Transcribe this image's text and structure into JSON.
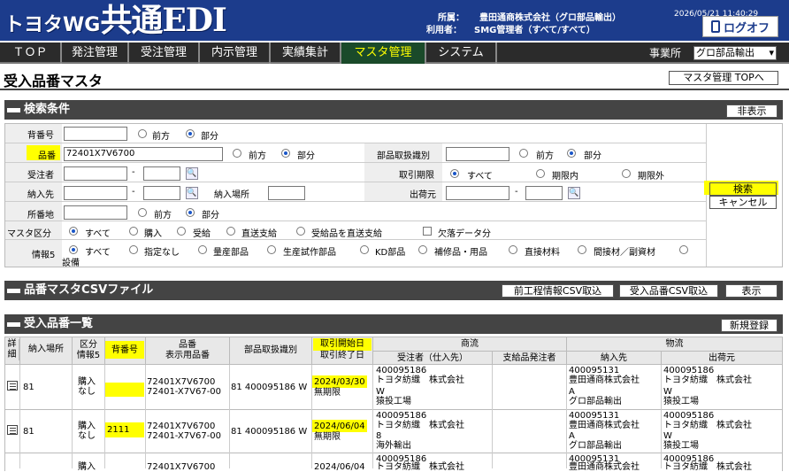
{
  "header": {
    "logo_small": "トヨタWG",
    "logo_big": "共通EDI",
    "affiliation_label": "所属：",
    "affiliation": "豊田通商株式会社（グロ部品輸出）",
    "user_label": "利用者：",
    "user": "SMG管理者（すべて/すべて）",
    "datetime": "2026/05/21 11:40:29",
    "logoff": "ログオフ"
  },
  "nav": {
    "items": [
      "ＴＯＰ",
      "発注管理",
      "受注管理",
      "内示管理",
      "実績集計",
      "マスタ管理",
      "システム"
    ],
    "office_label": "事業所",
    "office_value": "グロ部品輸出"
  },
  "page": {
    "title": "受入品番マスタ",
    "master_top": "マスタ管理 TOPへ"
  },
  "search": {
    "section_title": "検索条件",
    "hide": "非表示",
    "labels": {
      "sebango": "背番号",
      "hinban": "品番",
      "buhin": "部品取扱識別",
      "juchusha": "受注者",
      "torihiki": "取引期限",
      "nonyusaki": "納入先",
      "nonyubasho": "納入場所",
      "shukkamoto": "出荷元",
      "shozokuchi": "所番地",
      "master_kubun": "マスタ区分",
      "joho5": "情報5"
    },
    "hinban_value": "72401X7V6700",
    "opt_front": "前方",
    "opt_part": "部分",
    "opt_all": "すべて",
    "opt_within": "期限内",
    "opt_out": "期限外",
    "master_opts": [
      "すべて",
      "購入",
      "受給",
      "直送支給",
      "受給品を直送支給"
    ],
    "missing": "欠落データ分",
    "joho_opts": [
      "すべて",
      "指定なし",
      "量産部品",
      "生産試作部品",
      "KD部品",
      "補修品・用品",
      "直接材料",
      "間接材／副資材",
      "設備"
    ],
    "search_btn": "検索",
    "cancel_btn": "キャンセル"
  },
  "csv": {
    "section_title": "品番マスタCSVファイル",
    "btn1": "前工程情報CSV取込",
    "btn2": "受入品番CSV取込",
    "btn3": "表示"
  },
  "list": {
    "section_title": "受入品番一覧",
    "new_btn": "新規登録",
    "headers": {
      "detail": "詳細",
      "place": "納入場所",
      "kubun": "区分",
      "joho": "情報5",
      "sebango": "背番号",
      "hinban1": "品番",
      "hinban2": "表示用品番",
      "buhin": "部品取扱識別",
      "start": "取引開始日",
      "end": "取引終了日",
      "shoryu": "商流",
      "juchusha": "受注者（仕入先）",
      "shikyu": "支給品発注者",
      "butsuryu": "物流",
      "nonyusaki": "納入先",
      "shukkamoto": "出荷元"
    },
    "rows": [
      {
        "place": "81",
        "kubun": "購入",
        "joho": "なし",
        "sebango": "",
        "hin1": "72401X7V6700",
        "hin2": "72401-X7V67-00",
        "buhin": "81 400095186 W",
        "start": "2024/03/30",
        "end": "無期限",
        "j1": "400095186",
        "j2": "トヨタ紡織　株式会社",
        "j3": "W",
        "j4": "猿投工場",
        "n1": "400095131",
        "n2": "豊田通商株式会社",
        "n3": "A",
        "n4": "グロ部品輸出",
        "s1": "400095186",
        "s2": "トヨタ紡織　株式会社",
        "s3": "W",
        "s4": "猿投工場"
      },
      {
        "place": "81",
        "kubun": "購入",
        "joho": "なし",
        "sebango": "2111",
        "hin1": "72401X7V6700",
        "hin2": "72401-X7V67-00",
        "buhin": "81 400095186 W",
        "start": "2024/06/04",
        "end": "無期限",
        "j1": "400095186",
        "j2": "トヨタ紡織　株式会社",
        "j3": "8",
        "j4": "海外輸出",
        "n1": "400095131",
        "n2": "豊田通商株式会社",
        "n3": "A",
        "n4": "グロ部品輸出",
        "s1": "400095186",
        "s2": "トヨタ紡織　株式会社",
        "s3": "W",
        "s4": "猿投工場"
      },
      {
        "place": "",
        "kubun": "購入",
        "joho": "",
        "sebango": "",
        "hin1": "72401X7V6700",
        "hin2": "",
        "buhin": "",
        "start": "2024/06/04",
        "end": "",
        "j1": "400095186",
        "j2": "トヨタ紡織　株式会社",
        "j3": "",
        "j4": "",
        "n1": "400095131",
        "n2": "豊田通商株式会社",
        "n3": "",
        "n4": "",
        "s1": "400095186",
        "s2": "トヨタ紡織　株式会社",
        "s3": "",
        "s4": ""
      }
    ]
  }
}
